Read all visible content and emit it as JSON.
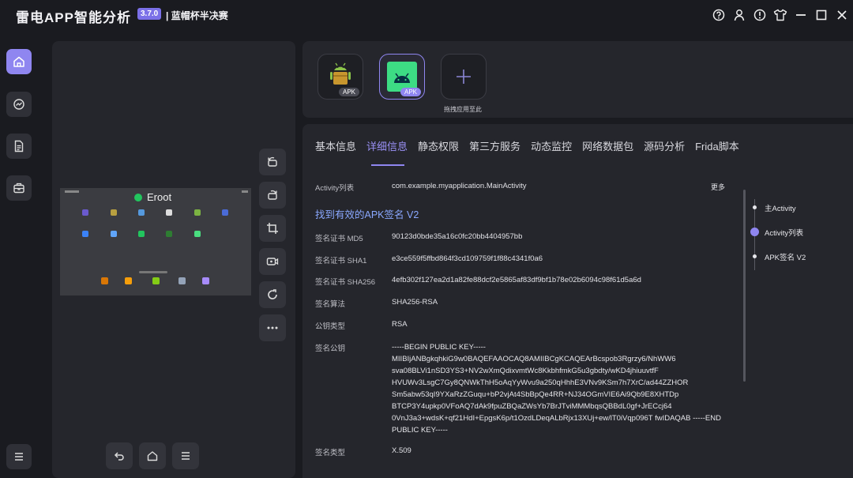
{
  "title_bar": {
    "app_title": "雷电APP智能分析",
    "version": "3.7.0",
    "subtitle": "| 蓝帽杯半决赛",
    "controls": [
      "help-icon",
      "user-icon",
      "alert-icon",
      "shirt-icon",
      "minimize-icon",
      "maximize-icon",
      "close-icon"
    ]
  },
  "left_nav": {
    "items": [
      "home-icon",
      "analysis-icon",
      "document-icon",
      "toolbox-icon",
      "menu-icon"
    ],
    "active": "home-icon"
  },
  "device": {
    "screen_label": "Eroot",
    "tools": [
      "rotate-left-icon",
      "rotate-right-icon",
      "crop-icon",
      "record-icon",
      "refresh-icon",
      "more-icon"
    ],
    "bottom_nav": [
      "back-icon",
      "home-icon",
      "menu-icon"
    ]
  },
  "apk_bar": {
    "items": [
      {
        "tag": "APK",
        "icon": "android-box-icon"
      },
      {
        "tag": "APK",
        "icon": "android-app-icon"
      }
    ],
    "add_label": "拖拽应用至此"
  },
  "tabs": [
    "基本信息",
    "详细信息",
    "静态权限",
    "第三方服务",
    "动态监控",
    "网络数据包",
    "源码分析",
    "Frida脚本"
  ],
  "active_tab": 1,
  "details": {
    "activity_label": "Activity列表",
    "activity_value": "com.example.myapplication.MainActivity",
    "more_label": "更多",
    "found_text": "找到有效的APK签名 V2",
    "rows": [
      {
        "label": "签名证书 MD5",
        "value": "90123d0bde35a16c0fc20bb4404957bb"
      },
      {
        "label": "签名证书 SHA1",
        "value": "e3ce559f5ffbd864f3cd109759f1f88c4341f0a6"
      },
      {
        "label": "签名证书 SHA256",
        "value": "4efb302f127ea2d1a82fe88dcf2e5865af83df9bf1b78e02b6094c98f61d5a6d"
      },
      {
        "label": "签名算法",
        "value": "SHA256-RSA"
      },
      {
        "label": "公钥类型",
        "value": "RSA"
      }
    ],
    "pubkey_label": "签名公钥",
    "pubkey_lines": [
      "-----BEGIN PUBLIC KEY-----",
      "MIIBIjANBgkqhkiG9w0BAQEFAAOCAQ8AMIIBCgKCAQEArBcspob3Rgrzy6/NhWW6",
      "sva08BLVi1nSD3YS3+NV2wXmQdixvmtWc8KkbhfmkG5u3gbdty/wKD4jhiuuvtfF",
      "HVUWv3LsgC7Gy8QNWkThH5oAqYyWvu9a250qHhhE3VNv9KSm7h7XrC/ad44ZZHOR",
      "Sm5abw53qI9YXaRzZGuqu+bP2vjAt4SbBpQe4RR+NJ34OGmVIE6Ai9Qb9E8XHTDp",
      "BTCP3Y4upkp0VFoAQ7dAk9fpuZBQaZWsYb7BrJTviMMMbqsQBBdL0gf+JrECcj64",
      "0VnJ3a3+wdsK+qf21HdI+EpgsK6p/t1OzdLDeqALbRjx13XUj+ew/lT0iVqp096T fwIDAQAB -----END",
      "PUBLIC KEY-----"
    ],
    "sig_type_label": "签名类型",
    "sig_type_value": "X.509"
  },
  "outline": [
    "主Activity",
    "Activity列表",
    "APK签名 V2"
  ],
  "outline_active": 1,
  "colors": {
    "accent": "#8f86f0",
    "link": "#8aa8ff",
    "panel": "#25262c",
    "bg": "#1a1b20"
  }
}
